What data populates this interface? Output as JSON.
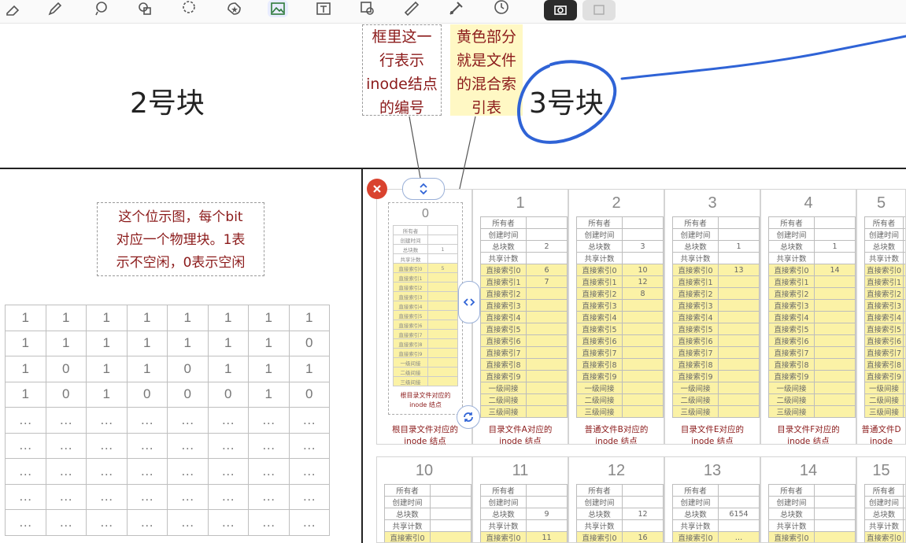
{
  "toolbar": {
    "tools": [
      "eraser-icon",
      "pen-icon",
      "lasso-shape-icon",
      "shapes-icon",
      "lasso-icon",
      "sticker-icon",
      "image-icon",
      "text-box-icon",
      "zoom-image-icon",
      "ruler-icon",
      "pointer-icon",
      "clock-icon",
      "camera-icon",
      "photo-icon"
    ]
  },
  "labels": {
    "block2": "2号块",
    "block3": "3号块"
  },
  "notes": {
    "inode_number": [
      "框里这一",
      "行表示",
      "inode结点",
      "的编号"
    ],
    "mixed_index": [
      "黄色部分",
      "就是文件",
      "的混合索",
      "引表"
    ],
    "bitmap": [
      "这个位示图，每个bit",
      "对应一个物理块。1表",
      "示不空闲，0表示空闲"
    ]
  },
  "bitmap": {
    "rows": [
      [
        "1",
        "1",
        "1",
        "1",
        "1",
        "1",
        "1",
        "1"
      ],
      [
        "1",
        "1",
        "1",
        "1",
        "1",
        "1",
        "1",
        "0"
      ],
      [
        "1",
        "0",
        "1",
        "1",
        "0",
        "1",
        "1",
        "1"
      ],
      [
        "1",
        "0",
        "1",
        "0",
        "0",
        "0",
        "1",
        "0"
      ],
      [
        "…",
        "…",
        "…",
        "…",
        "…",
        "…",
        "…",
        "…"
      ],
      [
        "…",
        "…",
        "…",
        "…",
        "…",
        "…",
        "…",
        "…"
      ],
      [
        "…",
        "…",
        "…",
        "…",
        "…",
        "…",
        "…",
        "…"
      ],
      [
        "…",
        "…",
        "…",
        "…",
        "…",
        "…",
        "…",
        "…"
      ],
      [
        "…",
        "…",
        "…",
        "…",
        "…",
        "…",
        "…",
        "…"
      ]
    ]
  },
  "inode_fields": {
    "header": [
      "所有者",
      "创建时间",
      "总块数",
      "共享计数"
    ],
    "direct": [
      "直接索引0",
      "直接索引1",
      "直接索引2",
      "直接索引3",
      "直接索引4",
      "直接索引5",
      "直接索引6",
      "直接索引7",
      "直接索引8",
      "直接索引9"
    ],
    "indirect": [
      "一级间接",
      "二级间接",
      "三级间接"
    ]
  },
  "root_card": {
    "number": "0",
    "caption": [
      "根目录文件对应的",
      "inode 结点"
    ],
    "inner_caption": [
      "根目录文件对应的",
      "inode 结点"
    ],
    "total_blocks": "1",
    "direct": [
      "5",
      "",
      "",
      "",
      "",
      "",
      "",
      "",
      "",
      ""
    ]
  },
  "cards_row1": [
    {
      "number": "1",
      "total_blocks": "2",
      "direct": [
        "6",
        "7",
        "",
        "",
        "",
        "",
        "",
        "",
        "",
        ""
      ],
      "caption": [
        "目录文件A对应的",
        "inode 结点"
      ]
    },
    {
      "number": "2",
      "total_blocks": "3",
      "direct": [
        "10",
        "12",
        "8",
        "",
        "",
        "",
        "",
        "",
        "",
        ""
      ],
      "caption": [
        "普通文件B对应的",
        "inode 结点"
      ]
    },
    {
      "number": "3",
      "total_blocks": "1",
      "direct": [
        "13",
        "",
        "",
        "",
        "",
        "",
        "",
        "",
        "",
        ""
      ],
      "caption": [
        "目录文件E对应的",
        "inode 结点"
      ]
    },
    {
      "number": "4",
      "total_blocks": "1",
      "direct": [
        "14",
        "",
        "",
        "",
        "",
        "",
        "",
        "",
        "",
        ""
      ],
      "caption": [
        "目录文件F对应的",
        "inode 结点"
      ]
    },
    {
      "number": "5",
      "total_blocks": "",
      "direct": [
        "",
        "",
        "",
        "",
        "",
        "",
        "",
        "",
        "",
        ""
      ],
      "caption": [
        "普通文件D",
        "inode"
      ]
    }
  ],
  "cards_row2": [
    {
      "number": "10",
      "total_blocks": "",
      "direct0": ""
    },
    {
      "number": "11",
      "total_blocks": "9",
      "direct0": "11"
    },
    {
      "number": "12",
      "total_blocks": "12",
      "direct0": "16"
    },
    {
      "number": "13",
      "total_blocks": "6154",
      "direct0": "…"
    },
    {
      "number": "14",
      "total_blocks": "",
      "direct0": ""
    },
    {
      "number": "15",
      "total_blocks": "",
      "direct0": ""
    }
  ],
  "colors": {
    "annotation": "#8b1a1a",
    "index_highlight": "#fbf2a6",
    "ink_blue": "#2f63d6",
    "close_red": "#d9432f"
  }
}
